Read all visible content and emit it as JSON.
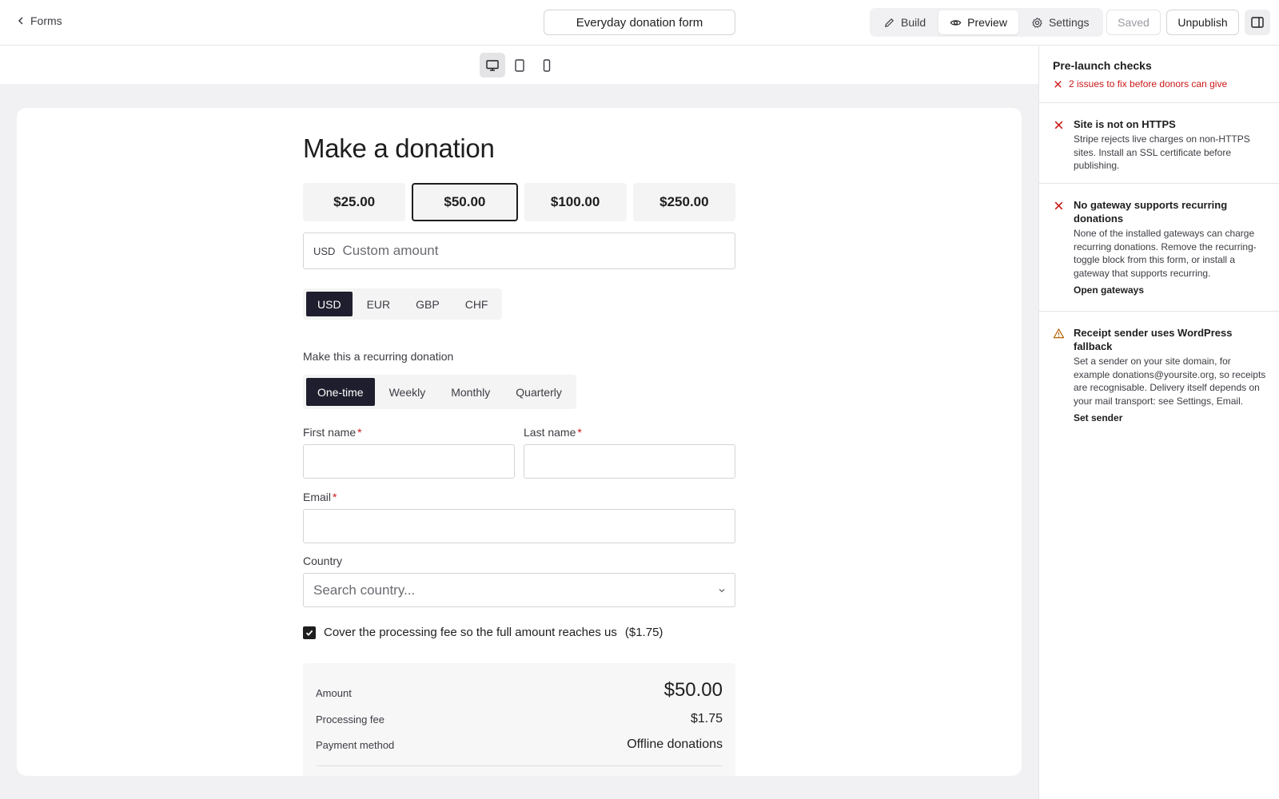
{
  "topbar": {
    "back_label": "Forms",
    "form_title": "Everyday donation form",
    "tabs": [
      {
        "label": "Build",
        "icon": "pencil-icon"
      },
      {
        "label": "Preview",
        "icon": "eye-icon"
      },
      {
        "label": "Settings",
        "icon": "gear-icon"
      }
    ],
    "active_tab": "Preview",
    "saved_label": "Saved",
    "unpublish_label": "Unpublish"
  },
  "device_bar": {
    "devices": [
      "desktop",
      "tablet",
      "mobile"
    ],
    "active": "desktop"
  },
  "form": {
    "title": "Make a donation",
    "amounts": [
      "$25.00",
      "$50.00",
      "$100.00",
      "$250.00"
    ],
    "selected_amount": "$50.00",
    "custom_amount": {
      "currency": "USD",
      "placeholder": "Custom amount"
    },
    "currencies": [
      "USD",
      "EUR",
      "GBP",
      "CHF"
    ],
    "selected_currency": "USD",
    "recurring_label": "Make this a recurring donation",
    "frequencies": [
      "One-time",
      "Weekly",
      "Monthly",
      "Quarterly"
    ],
    "selected_frequency": "One-time",
    "first_name_label": "First name",
    "last_name_label": "Last name",
    "email_label": "Email",
    "required_mark": "*",
    "country_label": "Country",
    "country_placeholder": "Search country...",
    "fee_text": "Cover the processing fee so the full amount reaches us",
    "fee_amount": "($1.75)",
    "fee_checked": true,
    "summary": {
      "amount_label": "Amount",
      "amount_value": "$50.00",
      "fee_label": "Processing fee",
      "fee_value": "$1.75",
      "method_label": "Payment method",
      "method_value": "Offline donations"
    }
  },
  "panel": {
    "title": "Pre-launch checks",
    "subtitle": "2 issues to fix before donors can give",
    "issues": [
      {
        "severity": "error",
        "title": "Site is not on HTTPS",
        "description": "Stripe rejects live charges on non-HTTPS sites. Install an SSL certificate before publishing.",
        "link": ""
      },
      {
        "severity": "error",
        "title": "No gateway supports recurring donations",
        "description": "None of the installed gateways can charge recurring donations. Remove the recurring-toggle block from this form, or install a gateway that supports recurring.",
        "link": "Open gateways"
      },
      {
        "severity": "warning",
        "title": "Receipt sender uses WordPress fallback",
        "description": "Set a sender on your site domain, for example donations@yoursite.org, so receipts are recognisable. Delivery itself depends on your mail transport: see Settings, Email.",
        "link": "Set sender"
      }
    ]
  },
  "colors": {
    "error": "#cc1818",
    "warning": "#b26200",
    "active_segment": "#1e1e2e"
  }
}
